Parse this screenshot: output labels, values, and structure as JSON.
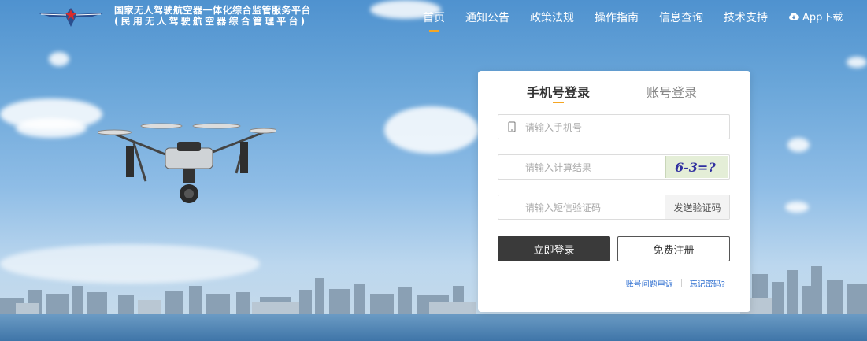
{
  "header": {
    "brand_line1": "国家无人驾驶航空器一体化综合监管服务平台",
    "brand_line2": "(民用无人驾驶航空器综合管理平台)",
    "nav": [
      {
        "label": "首页",
        "active": true
      },
      {
        "label": "通知公告",
        "active": false
      },
      {
        "label": "政策法规",
        "active": false
      },
      {
        "label": "操作指南",
        "active": false
      },
      {
        "label": "信息查询",
        "active": false
      },
      {
        "label": "技术支持",
        "active": false
      }
    ],
    "app_label": "App下载"
  },
  "login": {
    "tab_phone": "手机号登录",
    "tab_account": "账号登录",
    "phone_placeholder": "请输入手机号",
    "calc_placeholder": "请输入计算结果",
    "captcha_text": "6-3=?",
    "sms_placeholder": "请输入短信验证码",
    "sms_button": "发送验证码",
    "login_button": "立即登录",
    "register_button": "免费注册",
    "appeal_link": "账号问题申诉",
    "forgot_link": "忘记密码?"
  },
  "colors": {
    "accent": "#f5a623",
    "dark_button": "#3a3a3a",
    "link": "#2f6fd0"
  }
}
